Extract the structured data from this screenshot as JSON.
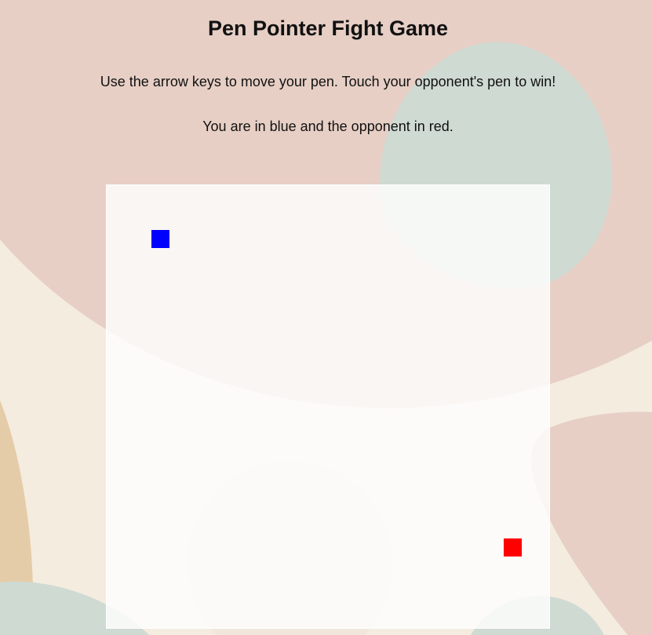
{
  "page": {
    "title": "Pen Pointer Fight Game",
    "instructions": "Use the arrow keys to move your pen. Touch your opponent's pen to win!",
    "color_info": "You are in blue and the opponent in red."
  },
  "colors": {
    "background": "#f4ecdf",
    "blob_pink": "#e7cfc5",
    "blob_sage": "#cfdad3",
    "blob_tan": "#e5cca8",
    "player_pen": "#0000ff",
    "opponent_pen": "#ff0000",
    "arena": "#fdfbf7"
  },
  "game": {
    "player": {
      "label": "blue",
      "icon": "blue-square-pen"
    },
    "opponent": {
      "label": "red",
      "icon": "red-square-pen"
    }
  }
}
